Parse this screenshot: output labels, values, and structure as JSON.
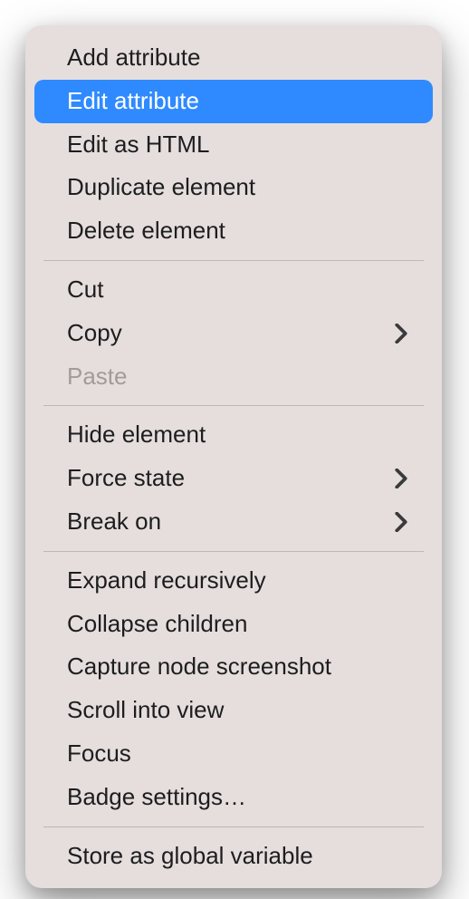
{
  "menu": {
    "groups": [
      [
        {
          "id": "add-attribute",
          "label": "Add attribute",
          "submenu": false,
          "disabled": false,
          "selected": false
        },
        {
          "id": "edit-attribute",
          "label": "Edit attribute",
          "submenu": false,
          "disabled": false,
          "selected": true
        },
        {
          "id": "edit-as-html",
          "label": "Edit as HTML",
          "submenu": false,
          "disabled": false,
          "selected": false
        },
        {
          "id": "duplicate-element",
          "label": "Duplicate element",
          "submenu": false,
          "disabled": false,
          "selected": false
        },
        {
          "id": "delete-element",
          "label": "Delete element",
          "submenu": false,
          "disabled": false,
          "selected": false
        }
      ],
      [
        {
          "id": "cut",
          "label": "Cut",
          "submenu": false,
          "disabled": false,
          "selected": false
        },
        {
          "id": "copy",
          "label": "Copy",
          "submenu": true,
          "disabled": false,
          "selected": false
        },
        {
          "id": "paste",
          "label": "Paste",
          "submenu": false,
          "disabled": true,
          "selected": false
        }
      ],
      [
        {
          "id": "hide-element",
          "label": "Hide element",
          "submenu": false,
          "disabled": false,
          "selected": false
        },
        {
          "id": "force-state",
          "label": "Force state",
          "submenu": true,
          "disabled": false,
          "selected": false
        },
        {
          "id": "break-on",
          "label": "Break on",
          "submenu": true,
          "disabled": false,
          "selected": false
        }
      ],
      [
        {
          "id": "expand-recursively",
          "label": "Expand recursively",
          "submenu": false,
          "disabled": false,
          "selected": false
        },
        {
          "id": "collapse-children",
          "label": "Collapse children",
          "submenu": false,
          "disabled": false,
          "selected": false
        },
        {
          "id": "capture-node-screenshot",
          "label": "Capture node screenshot",
          "submenu": false,
          "disabled": false,
          "selected": false
        },
        {
          "id": "scroll-into-view",
          "label": "Scroll into view",
          "submenu": false,
          "disabled": false,
          "selected": false
        },
        {
          "id": "focus",
          "label": "Focus",
          "submenu": false,
          "disabled": false,
          "selected": false
        },
        {
          "id": "badge-settings",
          "label": "Badge settings…",
          "submenu": false,
          "disabled": false,
          "selected": false
        }
      ],
      [
        {
          "id": "store-as-global-variable",
          "label": "Store as global variable",
          "submenu": false,
          "disabled": false,
          "selected": false
        }
      ]
    ]
  },
  "colors": {
    "menuBg": "#e5dedd",
    "highlight": "#2f8aff",
    "text": "#1d1d1f",
    "disabledText": "#a39b9a",
    "separator": "#bfb6b5"
  }
}
